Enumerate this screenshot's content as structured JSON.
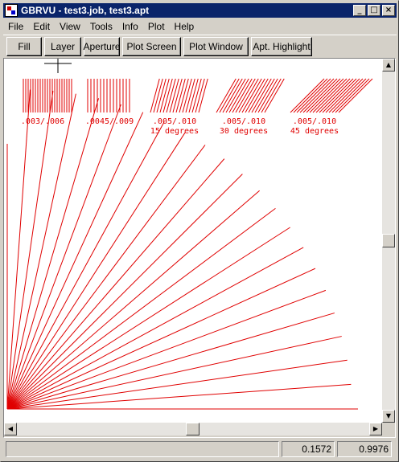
{
  "window": {
    "title": "GBRVU - test3.job, test3.apt",
    "caption_buttons": [
      "_",
      "□",
      "×"
    ]
  },
  "menu": [
    "File",
    "Edit",
    "View",
    "Tools",
    "Info",
    "Plot",
    "Help"
  ],
  "toolbar": [
    "Fill",
    "Layer",
    "Aperture",
    "Plot Screen",
    "Plot Window",
    "Apt. Highlight"
  ],
  "plot": {
    "color": "#e00000",
    "samples": [
      {
        "label": ".003/.006",
        "angle_label": ""
      },
      {
        "label": ".0045/.009",
        "angle_label": ""
      },
      {
        "label": ".005/.010",
        "angle_label": "15 degrees"
      },
      {
        "label": ".005/.010",
        "angle_label": "30 degrees"
      },
      {
        "label": ".005/.010",
        "angle_label": "45 degrees"
      }
    ]
  },
  "status": {
    "message": "",
    "x": "0.1572",
    "y": "0.9976"
  }
}
